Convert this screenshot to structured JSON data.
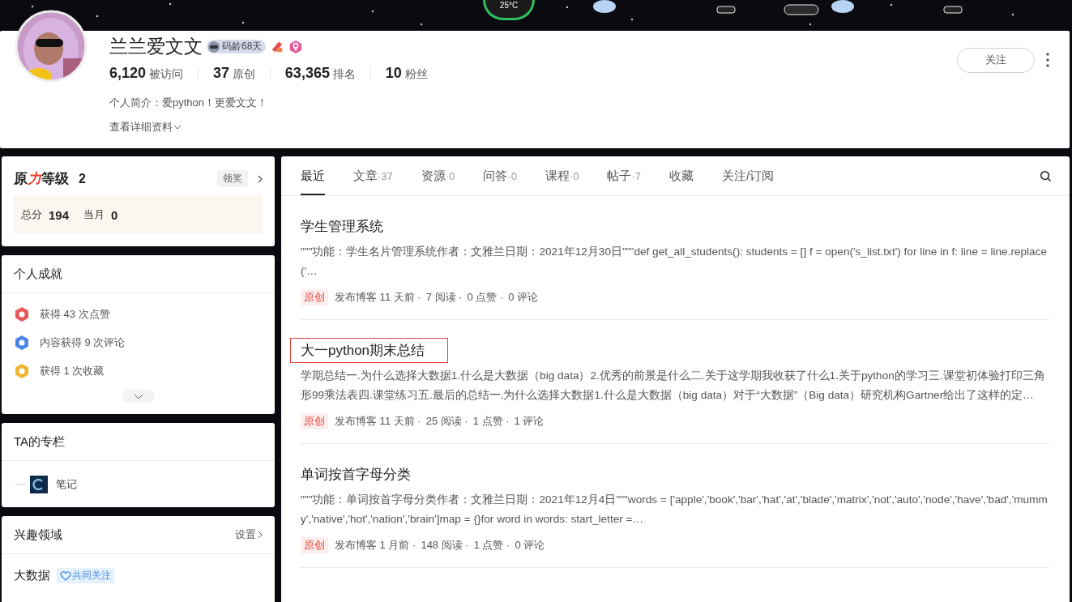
{
  "weather": {
    "temp": "25°C"
  },
  "profile": {
    "name": "兰兰爱文文",
    "code_age": "码龄68天",
    "stats": [
      {
        "value": "6,120",
        "label": "被访问"
      },
      {
        "value": "37",
        "label": "原创"
      },
      {
        "value": "63,365",
        "label": "排名"
      },
      {
        "value": "10",
        "label": "粉丝"
      }
    ],
    "bio": "个人简介：爱python！更爱文文！",
    "details_link": "查看详细资料",
    "follow_button": "关注"
  },
  "level_card": {
    "title_a": "原",
    "title_b": "力",
    "title_c": "等级",
    "level": "2",
    "reward": "领奖",
    "total_label": "总分",
    "total": "194",
    "month_label": "当月",
    "month": "0"
  },
  "achievements": {
    "title": "个人成就",
    "items": [
      {
        "kind": "like",
        "text": "获得 43 次点赞"
      },
      {
        "kind": "comment",
        "text": "内容获得 9 次评论"
      },
      {
        "kind": "favorite",
        "text": "获得 1 次收藏"
      }
    ]
  },
  "columns": {
    "title": "TA的专栏",
    "items": [
      {
        "name": "笔记"
      }
    ]
  },
  "interests": {
    "title": "兴趣领域",
    "settings": "设置",
    "items": [
      {
        "name": "大数据",
        "badge": "共同关注"
      }
    ]
  },
  "tabs": [
    {
      "label": "最近",
      "selected": true
    },
    {
      "label": "文章",
      "count": "·37",
      "selected": false
    },
    {
      "label": "资源",
      "count": "·0",
      "selected": false
    },
    {
      "label": "问答",
      "count": "·0",
      "selected": false
    },
    {
      "label": "课程",
      "count": "·0",
      "selected": false
    },
    {
      "label": "帖子",
      "count": "·7",
      "selected": false
    },
    {
      "label": "收藏",
      "selected": false
    },
    {
      "label": "关注/订阅",
      "selected": false
    }
  ],
  "articles": [
    {
      "title": "学生管理系统",
      "highlighted": false,
      "summary": "\"\"\"功能：学生名片管理系统作者：文雅兰日期：2021年12月30日\"\"\"def get_all_students(): students = [] f = open('s_list.txt') for line in f: line = line.replace('…",
      "tag": "原创",
      "meta": [
        "发布博客 11 天前 ·",
        "7 阅读 ·",
        "0 点赞 ·",
        "0 评论"
      ]
    },
    {
      "title": "大一python期末总结",
      "highlighted": true,
      "summary": "学期总结一.为什么选择大数据1.什么是大数据（big data）2.优秀的前景是什么二.关于这学期我收获了什么1.关于python的学习三.课堂初体验打印三角形99乘法表四.课堂练习五.最后的总结一.为什么选择大数据1.什么是大数据（big data）对于“大数据”（Big data）研究机构Gartner给出了这样的定…",
      "tag": "原创",
      "meta": [
        "发布博客 11 天前 ·",
        "25 阅读 ·",
        "1 点赞 ·",
        "1 评论"
      ]
    },
    {
      "title": "单词按首字母分类",
      "highlighted": false,
      "summary": "\"\"\"功能：单词按首字母分类作者：文雅兰日期：2021年12月4日\"\"\"words = ['apple','book','bar','hat','at','blade','matrix','not','auto','node','have','bad','mummy','native','hot','nation','brain']map = {}for word in words: start_letter =…",
      "tag": "原创",
      "meta": [
        "发布博客 1 月前 ·",
        "148 阅读 ·",
        "1 点赞 ·",
        "0 评论"
      ]
    }
  ]
}
